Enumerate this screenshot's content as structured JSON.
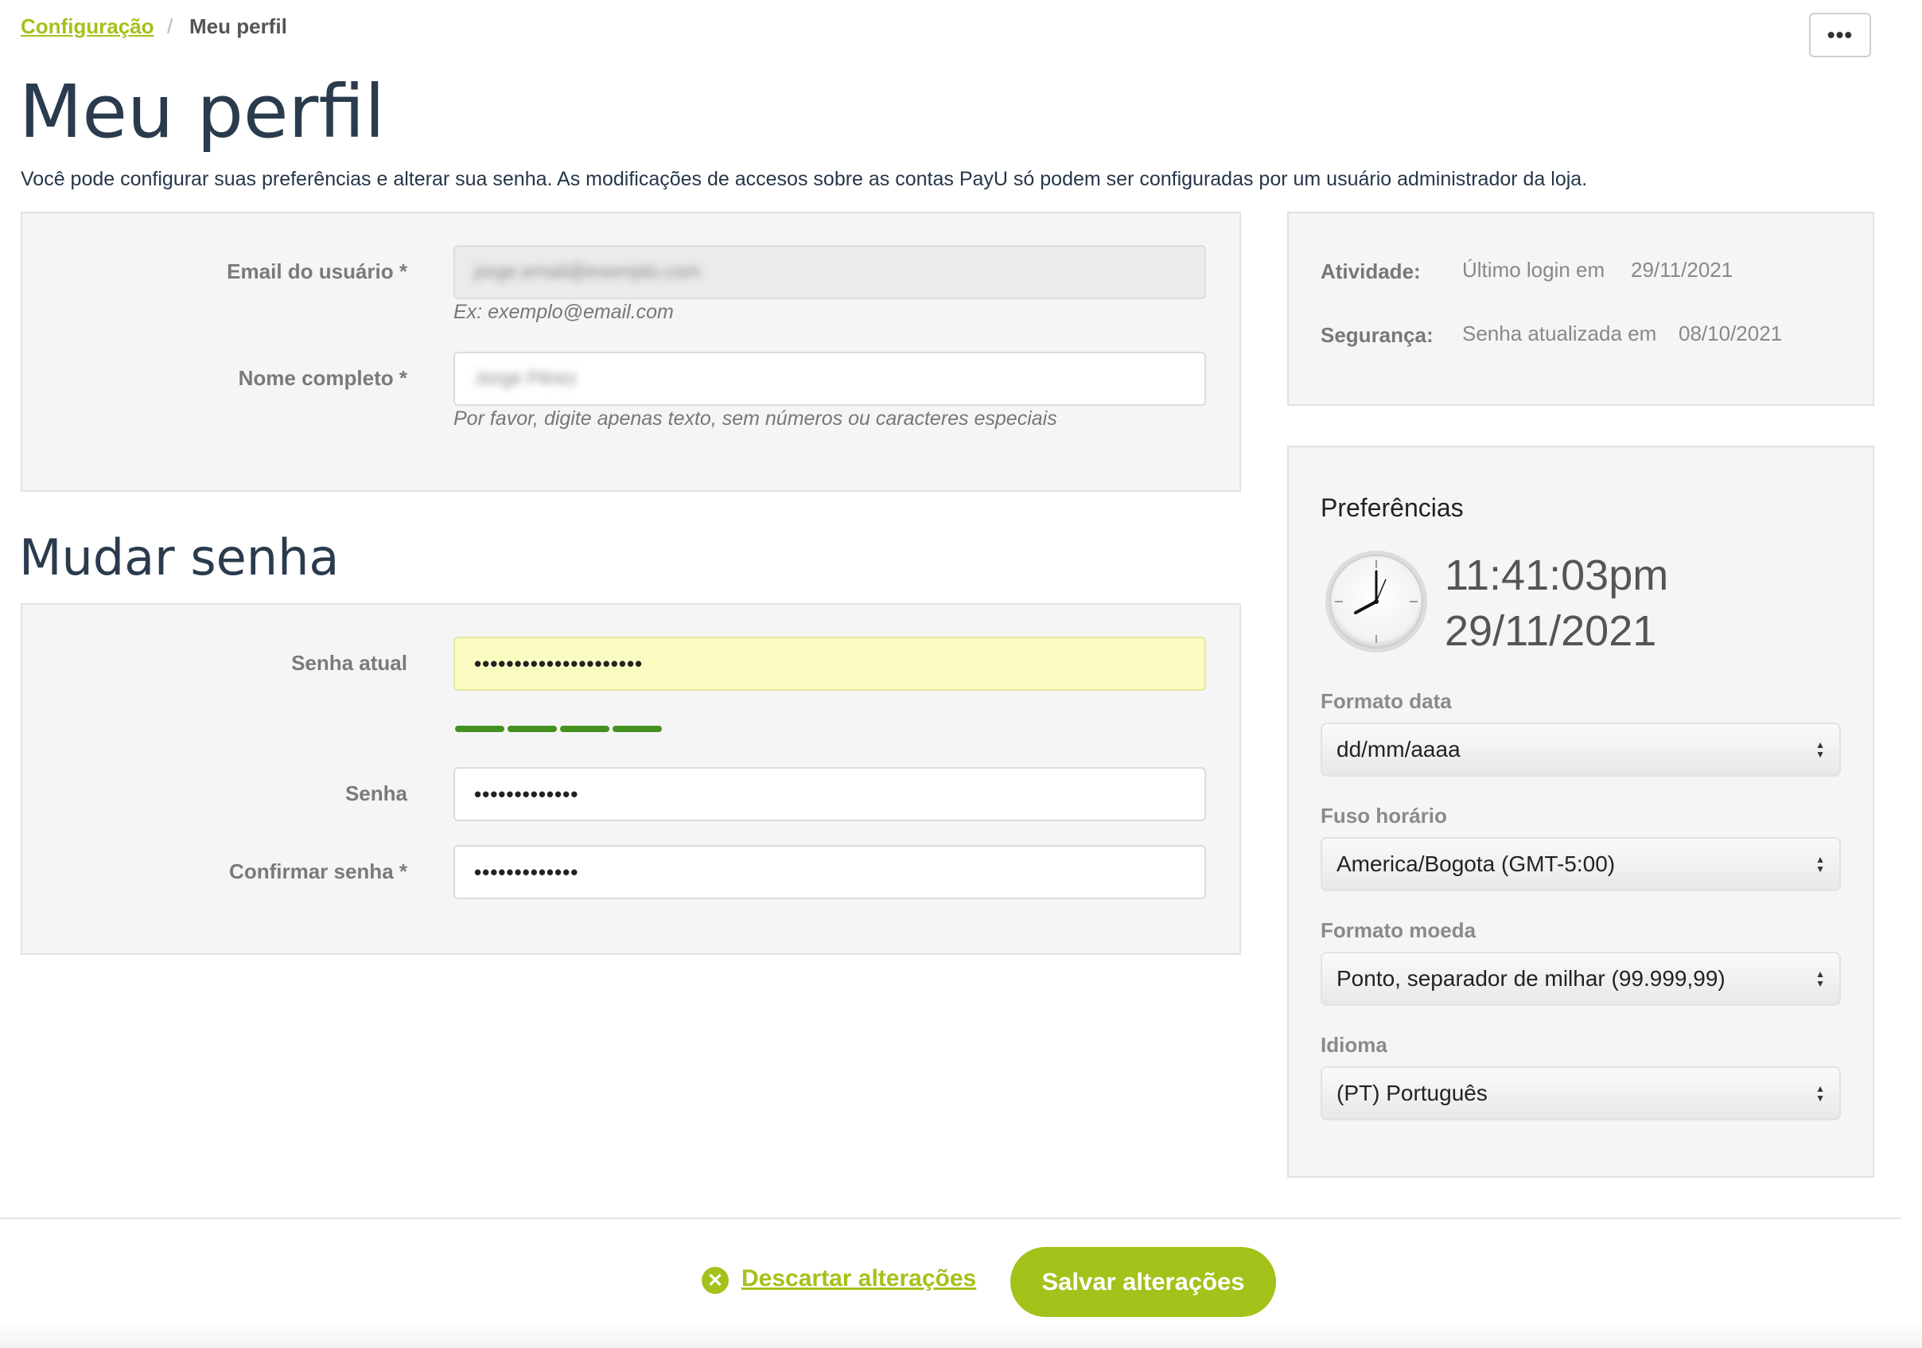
{
  "breadcrumb": {
    "parent": "Configuração",
    "separator": "/",
    "current": "Meu perfil"
  },
  "more_button": "•••",
  "title": "Meu perfil",
  "description": "Você pode configurar suas preferências e alterar sua senha. As modificações de accesos sobre as contas PayU só podem ser configuradas por um usuário administrador da loja.",
  "profile": {
    "email_label": "Email do usuário *",
    "email_value": "jorge.email@exemplo.com",
    "email_hint": "Ex: exemplo@email.com",
    "name_label": "Nome completo *",
    "name_value": "Jorge Pérez",
    "name_hint": "Por favor, digite apenas texto, sem números ou caracteres especiais"
  },
  "password": {
    "section_title": "Mudar senha",
    "current_label": "Senha atual",
    "current_value": "•••••••••••••••••••••",
    "strength_level": 1.0,
    "new_label": "Senha",
    "new_value": "•••••••••••••",
    "confirm_label": "Confirmar senha *",
    "confirm_value": "•••••••••••••"
  },
  "activity": {
    "activity_label": "Atividade:",
    "activity_text": "Último login em",
    "activity_date": "29/11/2021",
    "security_label": "Segurança:",
    "security_text": "Senha atualizada em",
    "security_date": "08/10/2021"
  },
  "preferences": {
    "title": "Preferências",
    "time": "11:41:03pm",
    "date": "29/11/2021",
    "date_format_label": "Formato data",
    "date_format_value": "dd/mm/aaaa",
    "timezone_label": "Fuso horário",
    "timezone_value": "America/Bogota (GMT-5:00)",
    "currency_label": "Formato moeda",
    "currency_value": "Ponto, separador de milhar (99.999,99)",
    "language_label": "Idioma",
    "language_value": "(PT) Português"
  },
  "footer": {
    "discard_label": "Descartar alterações",
    "save_label": "Salvar alterações"
  },
  "colors": {
    "accent": "#a3c21a",
    "strength": "#43911f",
    "title": "#2a3b4d"
  },
  "icons": [
    "more-icon",
    "clock-icon",
    "close-circle-icon",
    "select-arrows-icon"
  ]
}
